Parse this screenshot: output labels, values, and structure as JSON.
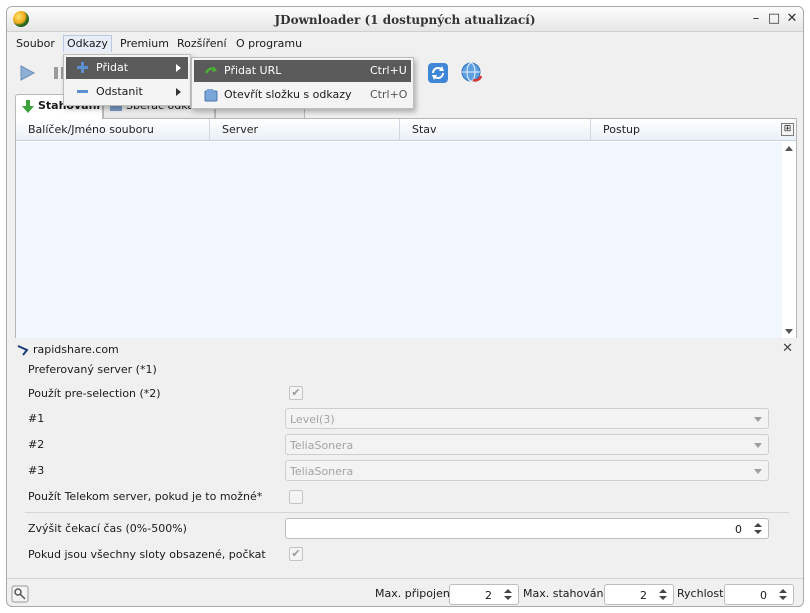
{
  "window": {
    "title": "JDownloader (1 dostupných atualizací)"
  },
  "menubar": {
    "items": [
      {
        "label": "Soubor"
      },
      {
        "label": "Odkazy"
      },
      {
        "label": "Premium"
      },
      {
        "label": "Rozšíření"
      },
      {
        "label": "O programu"
      }
    ]
  },
  "links_menu": {
    "items": [
      {
        "label": "Přidat",
        "icon": "plus-icon"
      },
      {
        "label": "Odstanit",
        "icon": "minus-icon"
      }
    ]
  },
  "add_submenu": {
    "items": [
      {
        "label": "Přidat URL",
        "shortcut": "Ctrl+U",
        "icon": "add-url-icon"
      },
      {
        "label": "Otevřít složku s odkazy",
        "shortcut": "Ctrl+O",
        "icon": "folder-icon"
      }
    ]
  },
  "tabs": [
    {
      "label": "Stahování"
    },
    {
      "label": "Sběrač odkazů"
    },
    {
      "label": ""
    }
  ],
  "table": {
    "columns": [
      "Balíček/Jméno souboru",
      "Server",
      "Stav",
      "Postup"
    ]
  },
  "detail": {
    "host": "rapidshare.com",
    "preferred_server_label": "Preferovaný server (*1)",
    "preselection_label": "Použít pre-selection (*2)",
    "preselection_checked": true,
    "selects": [
      {
        "label": "#1",
        "value": "Level(3)"
      },
      {
        "label": "#2",
        "value": "TeliaSonera"
      },
      {
        "label": "#3",
        "value": "TeliaSonera"
      }
    ],
    "telekom_label": "Použít Telekom server, pokud je to možné*",
    "telekom_checked": false,
    "wait_label": "Zvýšit čekací čas (0%-500%)",
    "wait_value": "0",
    "slots_label": "Pokud jsou všechny sloty obsazené, počkat",
    "slots_checked": true
  },
  "status": {
    "max_connections_label": "Max. připojení",
    "max_connections_value": "2",
    "max_downloads_label": "Max. stahování",
    "max_downloads_value": "2",
    "speed_label": "Rychlost",
    "speed_value": "0"
  }
}
